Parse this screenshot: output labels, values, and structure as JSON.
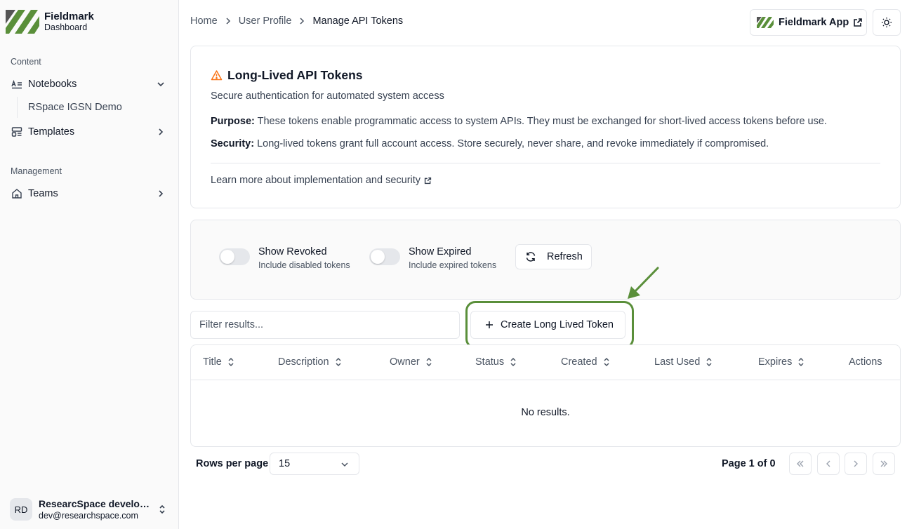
{
  "brand": {
    "name": "Fieldmark",
    "subtitle": "Dashboard",
    "logo_color": "#5a8f3a"
  },
  "sidebar": {
    "section_content": "Content",
    "notebooks_label": "Notebooks",
    "notebooks_sub": "RSpace IGSN Demo",
    "templates_label": "Templates",
    "section_management": "Management",
    "teams_label": "Teams"
  },
  "user": {
    "initials": "RD",
    "name": "ResearcSpace developer",
    "email": "dev@researchspace.com"
  },
  "breadcrumb": {
    "home": "Home",
    "profile": "User Profile",
    "current": "Manage API Tokens"
  },
  "header": {
    "app_button": "Fieldmark App"
  },
  "info": {
    "title": "Long-Lived API Tokens",
    "subtitle": "Secure authentication for automated system access",
    "purpose_label": "Purpose:",
    "purpose_text": " These tokens enable programmatic access to system APIs. They must be exchanged for short-lived access tokens before use.",
    "security_label": "Security:",
    "security_text": " Long-lived tokens grant full account access. Store securely, never share, and revoke immediately if compromised.",
    "learn_more": "Learn more about implementation and security",
    "warning_color": "#f97316"
  },
  "controls": {
    "show_revoked": "Show Revoked",
    "show_revoked_desc": "Include disabled tokens",
    "show_expired": "Show Expired",
    "show_expired_desc": "Include expired tokens",
    "refresh": "Refresh"
  },
  "filter": {
    "placeholder": "Filter results..."
  },
  "create_button": "Create Long Lived Token",
  "highlight_color": "#5a8f3a",
  "table": {
    "columns": [
      "Title",
      "Description",
      "Owner",
      "Status",
      "Created",
      "Last Used",
      "Expires",
      "Actions"
    ],
    "empty": "No results."
  },
  "pagination": {
    "rows_label": "Rows per page",
    "rows_value": "15",
    "page_info": "Page 1 of 0"
  }
}
